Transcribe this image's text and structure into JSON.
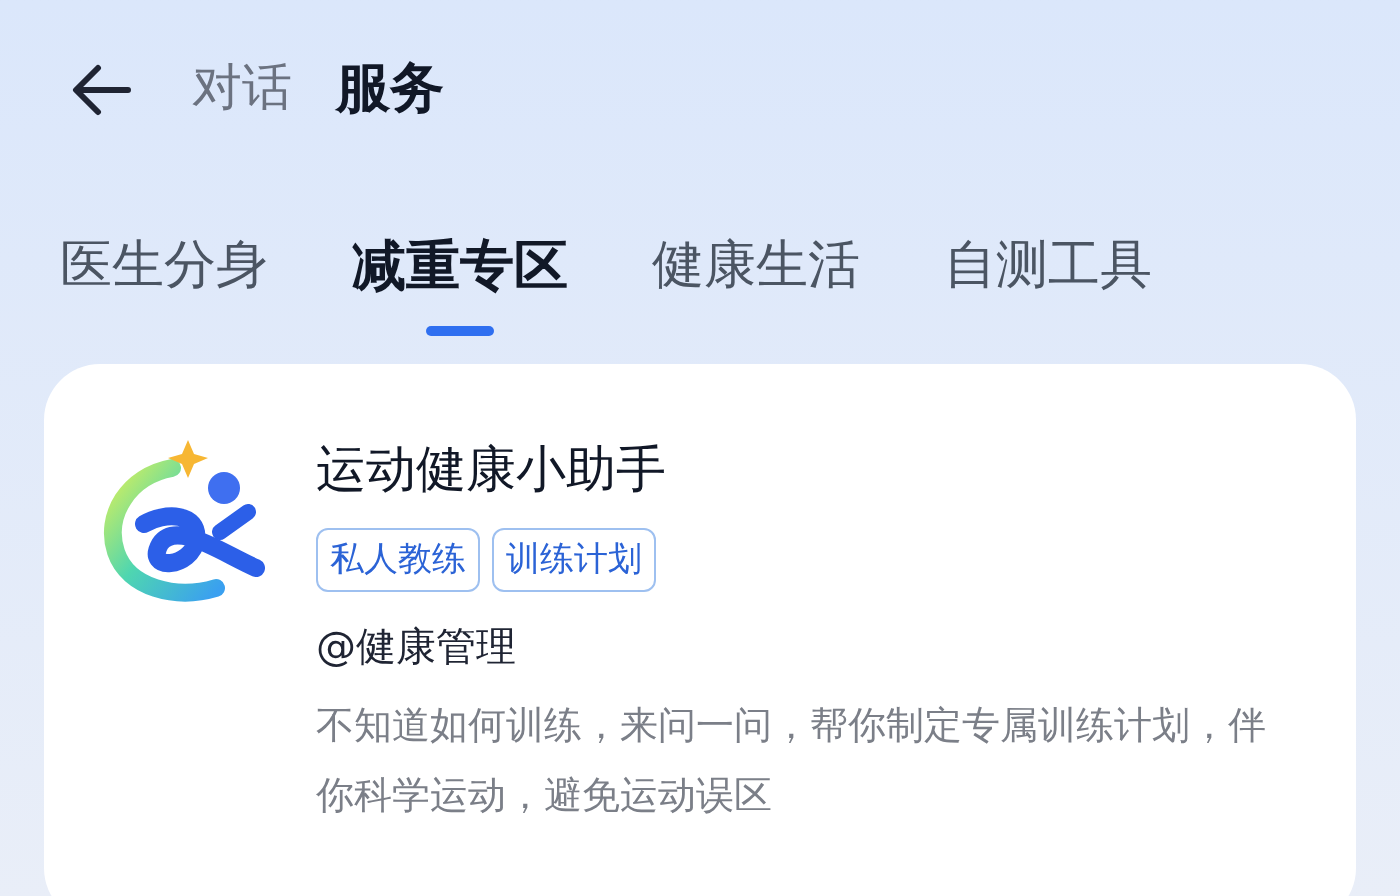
{
  "header": {
    "tabs": [
      {
        "label": "对话",
        "selected": false
      },
      {
        "label": "服务",
        "selected": true
      }
    ]
  },
  "categories": [
    {
      "label": "医生分身",
      "selected": false
    },
    {
      "label": "减重专区",
      "selected": true
    },
    {
      "label": "健康生活",
      "selected": false
    },
    {
      "label": "自测工具",
      "selected": false
    }
  ],
  "card": {
    "title": "运动健康小助手",
    "tags": [
      "私人教练",
      "训练计划"
    ],
    "provider": "@健康管理",
    "description": "不知道如何训练，来问一问，帮你制定专属训练计划，伴你科学运动，避免运动误区"
  }
}
